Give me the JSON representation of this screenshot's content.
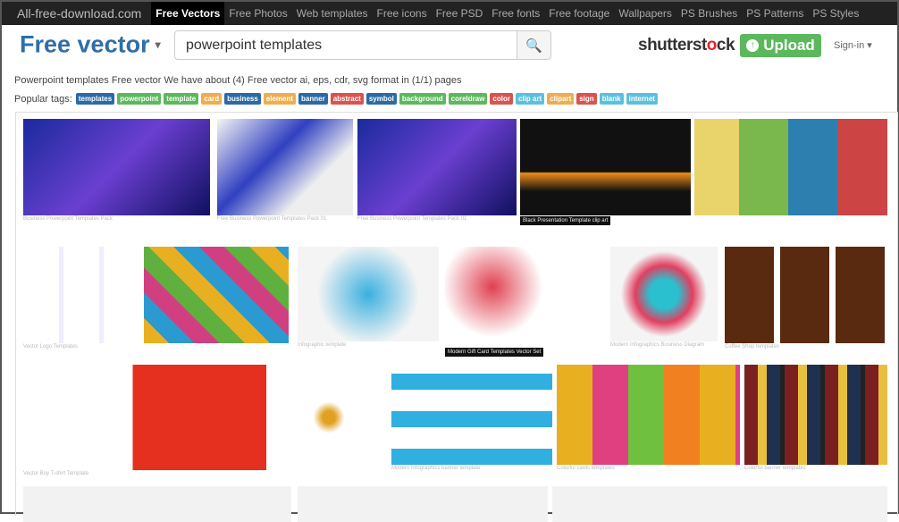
{
  "topbar": {
    "brand": "All-free-download.com",
    "items": [
      "Free Vectors",
      "Free Photos",
      "Web templates",
      "Free icons",
      "Free PSD",
      "Free fonts",
      "Free footage",
      "Wallpapers",
      "PS Brushes",
      "PS Patterns",
      "PS Styles"
    ],
    "active": "Free Vectors"
  },
  "header": {
    "logo": "Free vector",
    "logo_caret": "▾",
    "search_value": "powerpoint templates",
    "search_icon": "search-icon",
    "shutter_a": "shutterst",
    "shutter_b": "ck",
    "shutter_o": "o",
    "upload": "Upload",
    "signin": "Sign-in ▾"
  },
  "info": "Powerpoint templates Free vector We have about (4) Free vector ai, eps, cdr, svg format in (1/1) pages",
  "tags_label": "Popular tags:",
  "tags": [
    {
      "label": "templates",
      "color": "#2a6aa5"
    },
    {
      "label": "powerpoint",
      "color": "#5cb85c"
    },
    {
      "label": "template",
      "color": "#5cb85c"
    },
    {
      "label": "card",
      "color": "#f0ad4e"
    },
    {
      "label": "business",
      "color": "#2a6aa5"
    },
    {
      "label": "element",
      "color": "#f0ad4e"
    },
    {
      "label": "banner",
      "color": "#2a6aa5"
    },
    {
      "label": "abstract",
      "color": "#d9534f"
    },
    {
      "label": "symbol",
      "color": "#2a6aa5"
    },
    {
      "label": "background",
      "color": "#5cb85c"
    },
    {
      "label": "coreldraw",
      "color": "#5cb85c"
    },
    {
      "label": "color",
      "color": "#d9534f"
    },
    {
      "label": "clip art",
      "color": "#5bc0de"
    },
    {
      "label": "clipart",
      "color": "#f0ad4e"
    },
    {
      "label": "sign",
      "color": "#d9534f"
    },
    {
      "label": "blank",
      "color": "#5bc0de"
    },
    {
      "label": "internet",
      "color": "#5bc0de"
    }
  ],
  "thumbs": [
    {
      "caption": "Business Powerpoint Templates Pack",
      "bg": "linear-gradient(135deg,#1a2a9c,#6a3fd0 50%,#101060)"
    },
    {
      "caption": "Free Business Powerpoint Templates Pack 01",
      "bg": "linear-gradient(135deg,#f4f4f4,#3040c0 40%,#eee 70%)"
    },
    {
      "caption": "Free Business Powerpoint Templates Pack 01",
      "bg": "linear-gradient(135deg,#1a2a9c,#6a3fd0 50%,#101060)"
    },
    {
      "caption": "Black Presentation Template clip art",
      "bg": "linear-gradient(180deg,#111 55%,#f08c1a 56%,#111 75%)"
    },
    {
      "caption": "",
      "bg": "repeating-linear-gradient(90deg,#e9d36b 0 50px,#7ab84e 50px 105px,#2d7fb0 105px 160px,#c44 160px 216px)"
    },
    {
      "caption": "Vector Logo Templates",
      "bg": "repeating-linear-gradient(90deg,#fff 0 40px,#eef 40px 45px)"
    },
    {
      "caption": "",
      "bg": "repeating-linear-gradient(45deg,#e8b020 0 20px,#2a9ad0 20px 40px,#d04080 40px 60px,#60b040 60px 80px)"
    },
    {
      "caption": "Infographic template",
      "bg": "radial-gradient(circle,#3ab0e0,#f4f4f4 60%)"
    },
    {
      "caption": "Modern Gift Card Templates Vector Set",
      "bg": "radial-gradient(circle at 30% 40%,#e04050,#fff 40%),#fff"
    },
    {
      "caption": "Modern Infographics Business Diagram",
      "bg": "radial-gradient(circle,#2ac0d0 20%,#e04060 40%,#f4f4f4 60%)"
    },
    {
      "caption": "Coffee Shop templates",
      "bg": "repeating-linear-gradient(90deg,#5a2a10 0 55px,#fff 55px 62px)"
    },
    {
      "caption": "Vector Boy T-shirt Template",
      "bg": "linear-gradient(90deg,#fff 0 45%,#e53020 45% 100%)"
    },
    {
      "caption": "",
      "bg": "radial-gradient(circle,#e0a020 8%,#fff 20%)"
    },
    {
      "caption": "Modern infographics banner template",
      "bg": "repeating-linear-gradient(180deg,#fff 0 10px,#30b0e0 10px 28px,#fff 28px 42px)"
    },
    {
      "caption": "Colorful cards templates",
      "bg": "repeating-linear-gradient(90deg,#e8b020 0 40px,#e04080 40px 80px,#70c040 80px 120px,#f08020 120px 160px)"
    },
    {
      "caption": "Colorful banner templates",
      "bg": "repeating-linear-gradient(90deg,#7a2020 0 15px,#e8c040 15px 25px,#203050 25px 40px,#222 40px 45px)"
    }
  ]
}
